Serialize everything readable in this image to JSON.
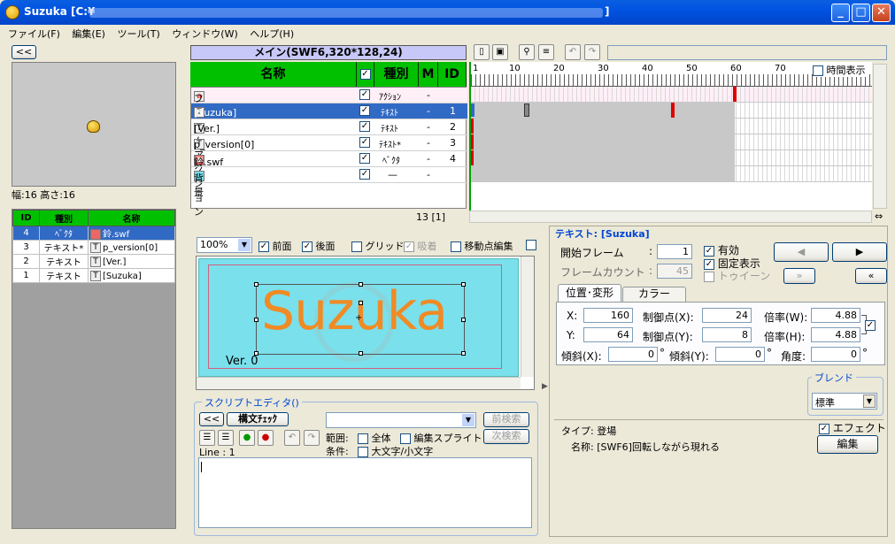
{
  "window": {
    "title": "Suzuka [C:¥",
    "title_end": "]",
    "btn_min": "_",
    "btn_max": "□",
    "btn_close": "✕"
  },
  "menu": [
    "ファイル(F)",
    "編集(E)",
    "ツール(T)",
    "ウィンドウ(W)",
    "ヘルプ(H)"
  ],
  "left": {
    "collapse_label": "<<",
    "size_text": "幅:16 高さ:16",
    "object_headers": [
      "ID",
      "種別",
      "名称"
    ],
    "objects": [
      {
        "id": "4",
        "type": "ﾍﾞｸﾀ",
        "name": "鈴.swf",
        "selected": true
      },
      {
        "id": "3",
        "type": "テキスト*",
        "name": "p_version[0]",
        "selected": false
      },
      {
        "id": "2",
        "type": "テキスト",
        "name": "[Ver.]",
        "selected": false
      },
      {
        "id": "1",
        "type": "テキスト",
        "name": "[Suzuka]",
        "selected": false
      }
    ]
  },
  "scene": {
    "title": "メイン(SWF6,320*128,24)",
    "headers": {
      "name": "名称",
      "type": "種別",
      "m": "M",
      "id": "ID"
    },
    "layers": [
      {
        "name": "フレームアクション",
        "icon": "a",
        "type": "ｱｸｼｮﾝ",
        "m": "-",
        "id": "",
        "style": "pink"
      },
      {
        "name": "[Suzuka]",
        "icon": "T",
        "type": "ﾃｷｽﾄ",
        "m": "-",
        "id": "1",
        "style": "sel"
      },
      {
        "name": "[Ver.]",
        "icon": "T",
        "type": "ﾃｷｽﾄ",
        "m": "-",
        "id": "2",
        "style": ""
      },
      {
        "name": "p_version[0]",
        "icon": "T",
        "type": "ﾃｷｽﾄ*",
        "m": "-",
        "id": "3",
        "style": ""
      },
      {
        "name": "鈴.swf",
        "icon": "▣",
        "type": "ﾍﾞｸﾀ",
        "m": "-",
        "id": "4",
        "style": ""
      },
      {
        "name": "背景",
        "icon": "",
        "type": "—",
        "m": "-",
        "id": "",
        "style": ""
      }
    ],
    "frame_status": "13 [1]"
  },
  "timeline": {
    "ticks": [
      "1",
      "10",
      "20",
      "30",
      "40",
      "50",
      "60",
      "70"
    ],
    "time_display_label": "時間表示"
  },
  "stage_toolbar": {
    "zoom": "100%",
    "front_label": "前面",
    "back_label": "後面",
    "grid_label": "グリッド",
    "snap_label": "吸着",
    "movepoint_label": "移動点編集"
  },
  "stage": {
    "main_text": "Suzuka",
    "ver_text": "Ver. 0"
  },
  "script": {
    "title": "スクリプトエディタ()",
    "collapse_label": "<<",
    "syntax_check": "構文ﾁｪｯｸ",
    "prev_search": "前検索",
    "next_search": "次検索",
    "range_label": "範囲:",
    "all_label": "全体",
    "edit_sprite_label": "編集スプライト",
    "condition_label": "条件:",
    "case_label": "大文字/小文字",
    "line_label": "Line : 1"
  },
  "props": {
    "title": "テキスト: [Suzuka]",
    "start_frame_label": "開始フレーム",
    "start_frame": "1",
    "frame_count_label": "フレームカウント",
    "frame_count": "45",
    "enabled_label": "有効",
    "fixed_label": "固定表示",
    "tween_label": "トゥイーン",
    "tab_pos": "位置･変形",
    "tab_color": "カラー",
    "x_label": "X:",
    "x": "160",
    "y_label": "Y:",
    "y": "64",
    "cx_label": "制御点(X):",
    "cx": "24",
    "cy_label": "制御点(Y):",
    "cy": "8",
    "sw_label": "倍率(W):",
    "sw": "4.88",
    "sh_label": "倍率(H):",
    "sh": "4.88",
    "skx_label": "傾斜(X):",
    "skx": "0",
    "sky_label": "傾斜(Y):",
    "sky": "0",
    "angle_label": "角度:",
    "angle": "0",
    "deg": "°",
    "blend_title": "ブレンド",
    "blend_value": "標準",
    "type_text": "タイプ: 登場",
    "name_text": "名称: [SWF6]回転しながら現れる",
    "effect_label": "エフェクト",
    "edit_button": "編集"
  }
}
